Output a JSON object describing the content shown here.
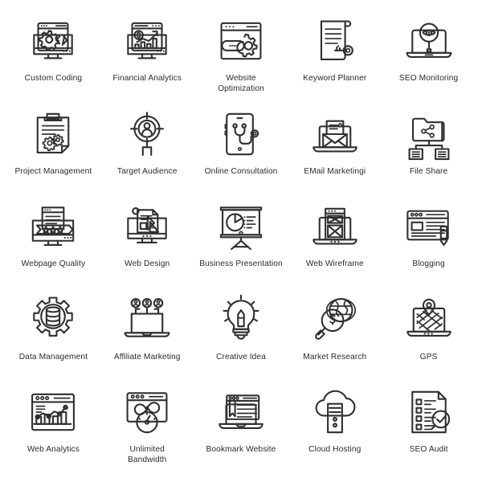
{
  "page": {
    "title": "SEO and Web Development Line Icons",
    "background_color": "#ffffff",
    "stroke_color": "#303030",
    "label_color": "#2b2b2b",
    "columns": 5,
    "rows": 5,
    "total_icons": 25
  },
  "icons": [
    {
      "id": "custom-coding",
      "label": "Custom Coding",
      "icon_name": "monitor-gear-code-icon"
    },
    {
      "id": "financial-analytics",
      "label": "Financial Analytics",
      "icon_name": "monitor-dollar-growth-chart-icon"
    },
    {
      "id": "website-optimization",
      "label": "Website\nOptimization",
      "icon_name": "browser-search-gear-icon"
    },
    {
      "id": "keyword-planner",
      "label": "Keyword Planner",
      "icon_name": "document-key-icon"
    },
    {
      "id": "seo-monitoring",
      "label": "SEO Monitoring",
      "icon_name": "laptop-magnifier-eye-icon"
    },
    {
      "id": "project-management",
      "label": "Project Management",
      "icon_name": "clipboard-gears-icon"
    },
    {
      "id": "target-audience",
      "label": "Target Audience",
      "icon_name": "target-user-icon"
    },
    {
      "id": "online-consultation",
      "label": "Online Consultation",
      "icon_name": "smartphone-stethoscope-icon"
    },
    {
      "id": "email-marketing",
      "label": "EMail Marketingi",
      "icon_name": "laptop-envelope-letter-icon"
    },
    {
      "id": "file-share",
      "label": "File Share",
      "icon_name": "folder-share-network-icon"
    },
    {
      "id": "webpage-quality",
      "label": "Webpage Quality",
      "icon_name": "monitor-star-rating-ribbon-icon"
    },
    {
      "id": "web-design",
      "label": "Web Design",
      "icon_name": "monitor-design-ruler-icon"
    },
    {
      "id": "business-presentation",
      "label": "Business Presentation",
      "icon_name": "presentation-board-pie-chart-icon"
    },
    {
      "id": "web-wireframe",
      "label": "Web Wireframe",
      "icon_name": "laptop-wireframe-blocks-icon"
    },
    {
      "id": "blogging",
      "label": "Blogging",
      "icon_name": "browser-article-pencil-icon"
    },
    {
      "id": "data-management",
      "label": "Data Management",
      "icon_name": "gear-database-icon"
    },
    {
      "id": "affiliate-marketing",
      "label": "Affiliate Marketing",
      "icon_name": "laptop-user-network-icon"
    },
    {
      "id": "creative-idea",
      "label": "Creative Idea",
      "icon_name": "lightbulb-pencil-icon"
    },
    {
      "id": "market-research",
      "label": "Market Research",
      "icon_name": "magnifier-dollar-globe-icon"
    },
    {
      "id": "gps",
      "label": "GPS",
      "icon_name": "laptop-map-pin-icon"
    },
    {
      "id": "web-analytics",
      "label": "Web Analytics",
      "icon_name": "browser-bar-line-chart-icon"
    },
    {
      "id": "unlimited-bandwidth",
      "label": "Unlimited\nBandwidth",
      "icon_name": "browser-infinity-gauge-icon"
    },
    {
      "id": "bookmark-website",
      "label": "Bookmark Website",
      "icon_name": "laptop-bookmark-article-icon"
    },
    {
      "id": "cloud-hosting",
      "label": "Cloud Hosting",
      "icon_name": "cloud-server-icon"
    },
    {
      "id": "seo-audit",
      "label": "SEO Audit",
      "icon_name": "checklist-document-verified-icon"
    }
  ]
}
